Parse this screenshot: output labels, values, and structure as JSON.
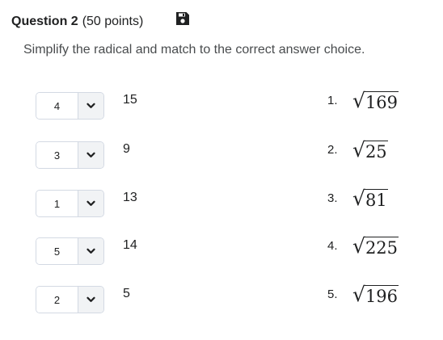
{
  "question": {
    "title": "Question 2",
    "points": "(50 points)",
    "instruction": "Simplify the radical and match to the correct answer choice."
  },
  "matches": [
    {
      "selected": "4",
      "value": "15"
    },
    {
      "selected": "3",
      "value": "9"
    },
    {
      "selected": "1",
      "value": "13"
    },
    {
      "selected": "5",
      "value": "14"
    },
    {
      "selected": "2",
      "value": "5"
    }
  ],
  "choices": [
    {
      "number": "1.",
      "radicand": "169"
    },
    {
      "number": "2.",
      "radicand": "25"
    },
    {
      "number": "3.",
      "radicand": "81"
    },
    {
      "number": "4.",
      "radicand": "225"
    },
    {
      "number": "5.",
      "radicand": "196"
    }
  ],
  "icons": {
    "save": "floppy-disk-icon",
    "dropdown": "chevron-down-icon"
  }
}
